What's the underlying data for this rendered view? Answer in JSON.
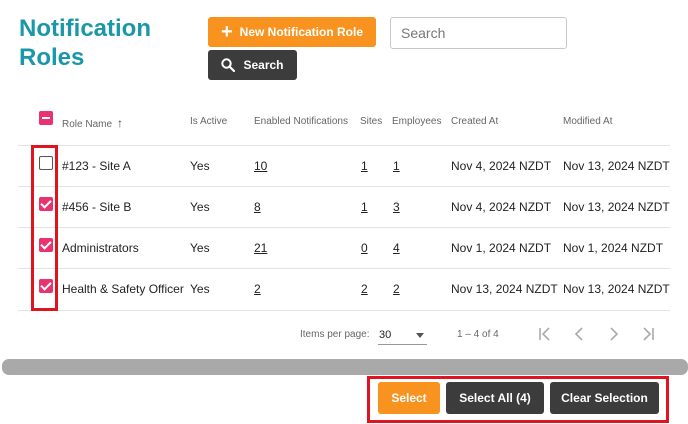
{
  "page": {
    "title": "Notification Roles"
  },
  "toolbar": {
    "new_role_label": "New Notification Role",
    "search_placeholder": "Search",
    "search_button_label": "Search"
  },
  "table": {
    "columns": [
      "Role Name",
      "Is Active",
      "Enabled Notifications",
      "Sites",
      "Employees",
      "Created At",
      "Modified At"
    ],
    "sort_indicator": "↑",
    "select_all_state": "indeterminate",
    "rows": [
      {
        "checked": false,
        "role_name": "#123 - Site A",
        "is_active": "Yes",
        "enabled_notifications": "10",
        "sites": "1",
        "employees": "1",
        "created_at": "Nov 4, 2024 NZDT",
        "modified_at": "Nov 13, 2024 NZDT"
      },
      {
        "checked": true,
        "role_name": "#456 - Site B",
        "is_active": "Yes",
        "enabled_notifications": "8",
        "sites": "1",
        "employees": "3",
        "created_at": "Nov 4, 2024 NZDT",
        "modified_at": "Nov 13, 2024 NZDT"
      },
      {
        "checked": true,
        "role_name": "Administrators",
        "is_active": "Yes",
        "enabled_notifications": "21",
        "sites": "0",
        "employees": "4",
        "created_at": "Nov 1, 2024 NZDT",
        "modified_at": "Nov 1, 2024 NZDT"
      },
      {
        "checked": true,
        "role_name": "Health & Safety Officer",
        "is_active": "Yes",
        "enabled_notifications": "2",
        "sites": "2",
        "employees": "2",
        "created_at": "Nov 13, 2024 NZDT",
        "modified_at": "Nov 13, 2024 NZDT"
      }
    ]
  },
  "paginator": {
    "items_per_page_label": "Items per page:",
    "items_per_page_value": "30",
    "range_label": "1 – 4 of 4"
  },
  "actions": {
    "select_label": "Select",
    "select_all_label": "Select All (4)",
    "clear_selection_label": "Clear Selection"
  },
  "colors": {
    "accent_teal": "#1a97a8",
    "accent_orange": "#f7931e",
    "checkbox_pink": "#e8336e",
    "dark_button": "#3c3c3c",
    "highlight_red": "#e0141e"
  },
  "icons": [
    "plus-icon",
    "search-icon",
    "sort-ascending-icon",
    "first-page-icon",
    "previous-page-icon",
    "next-page-icon",
    "last-page-icon",
    "dropdown-caret-icon"
  ]
}
